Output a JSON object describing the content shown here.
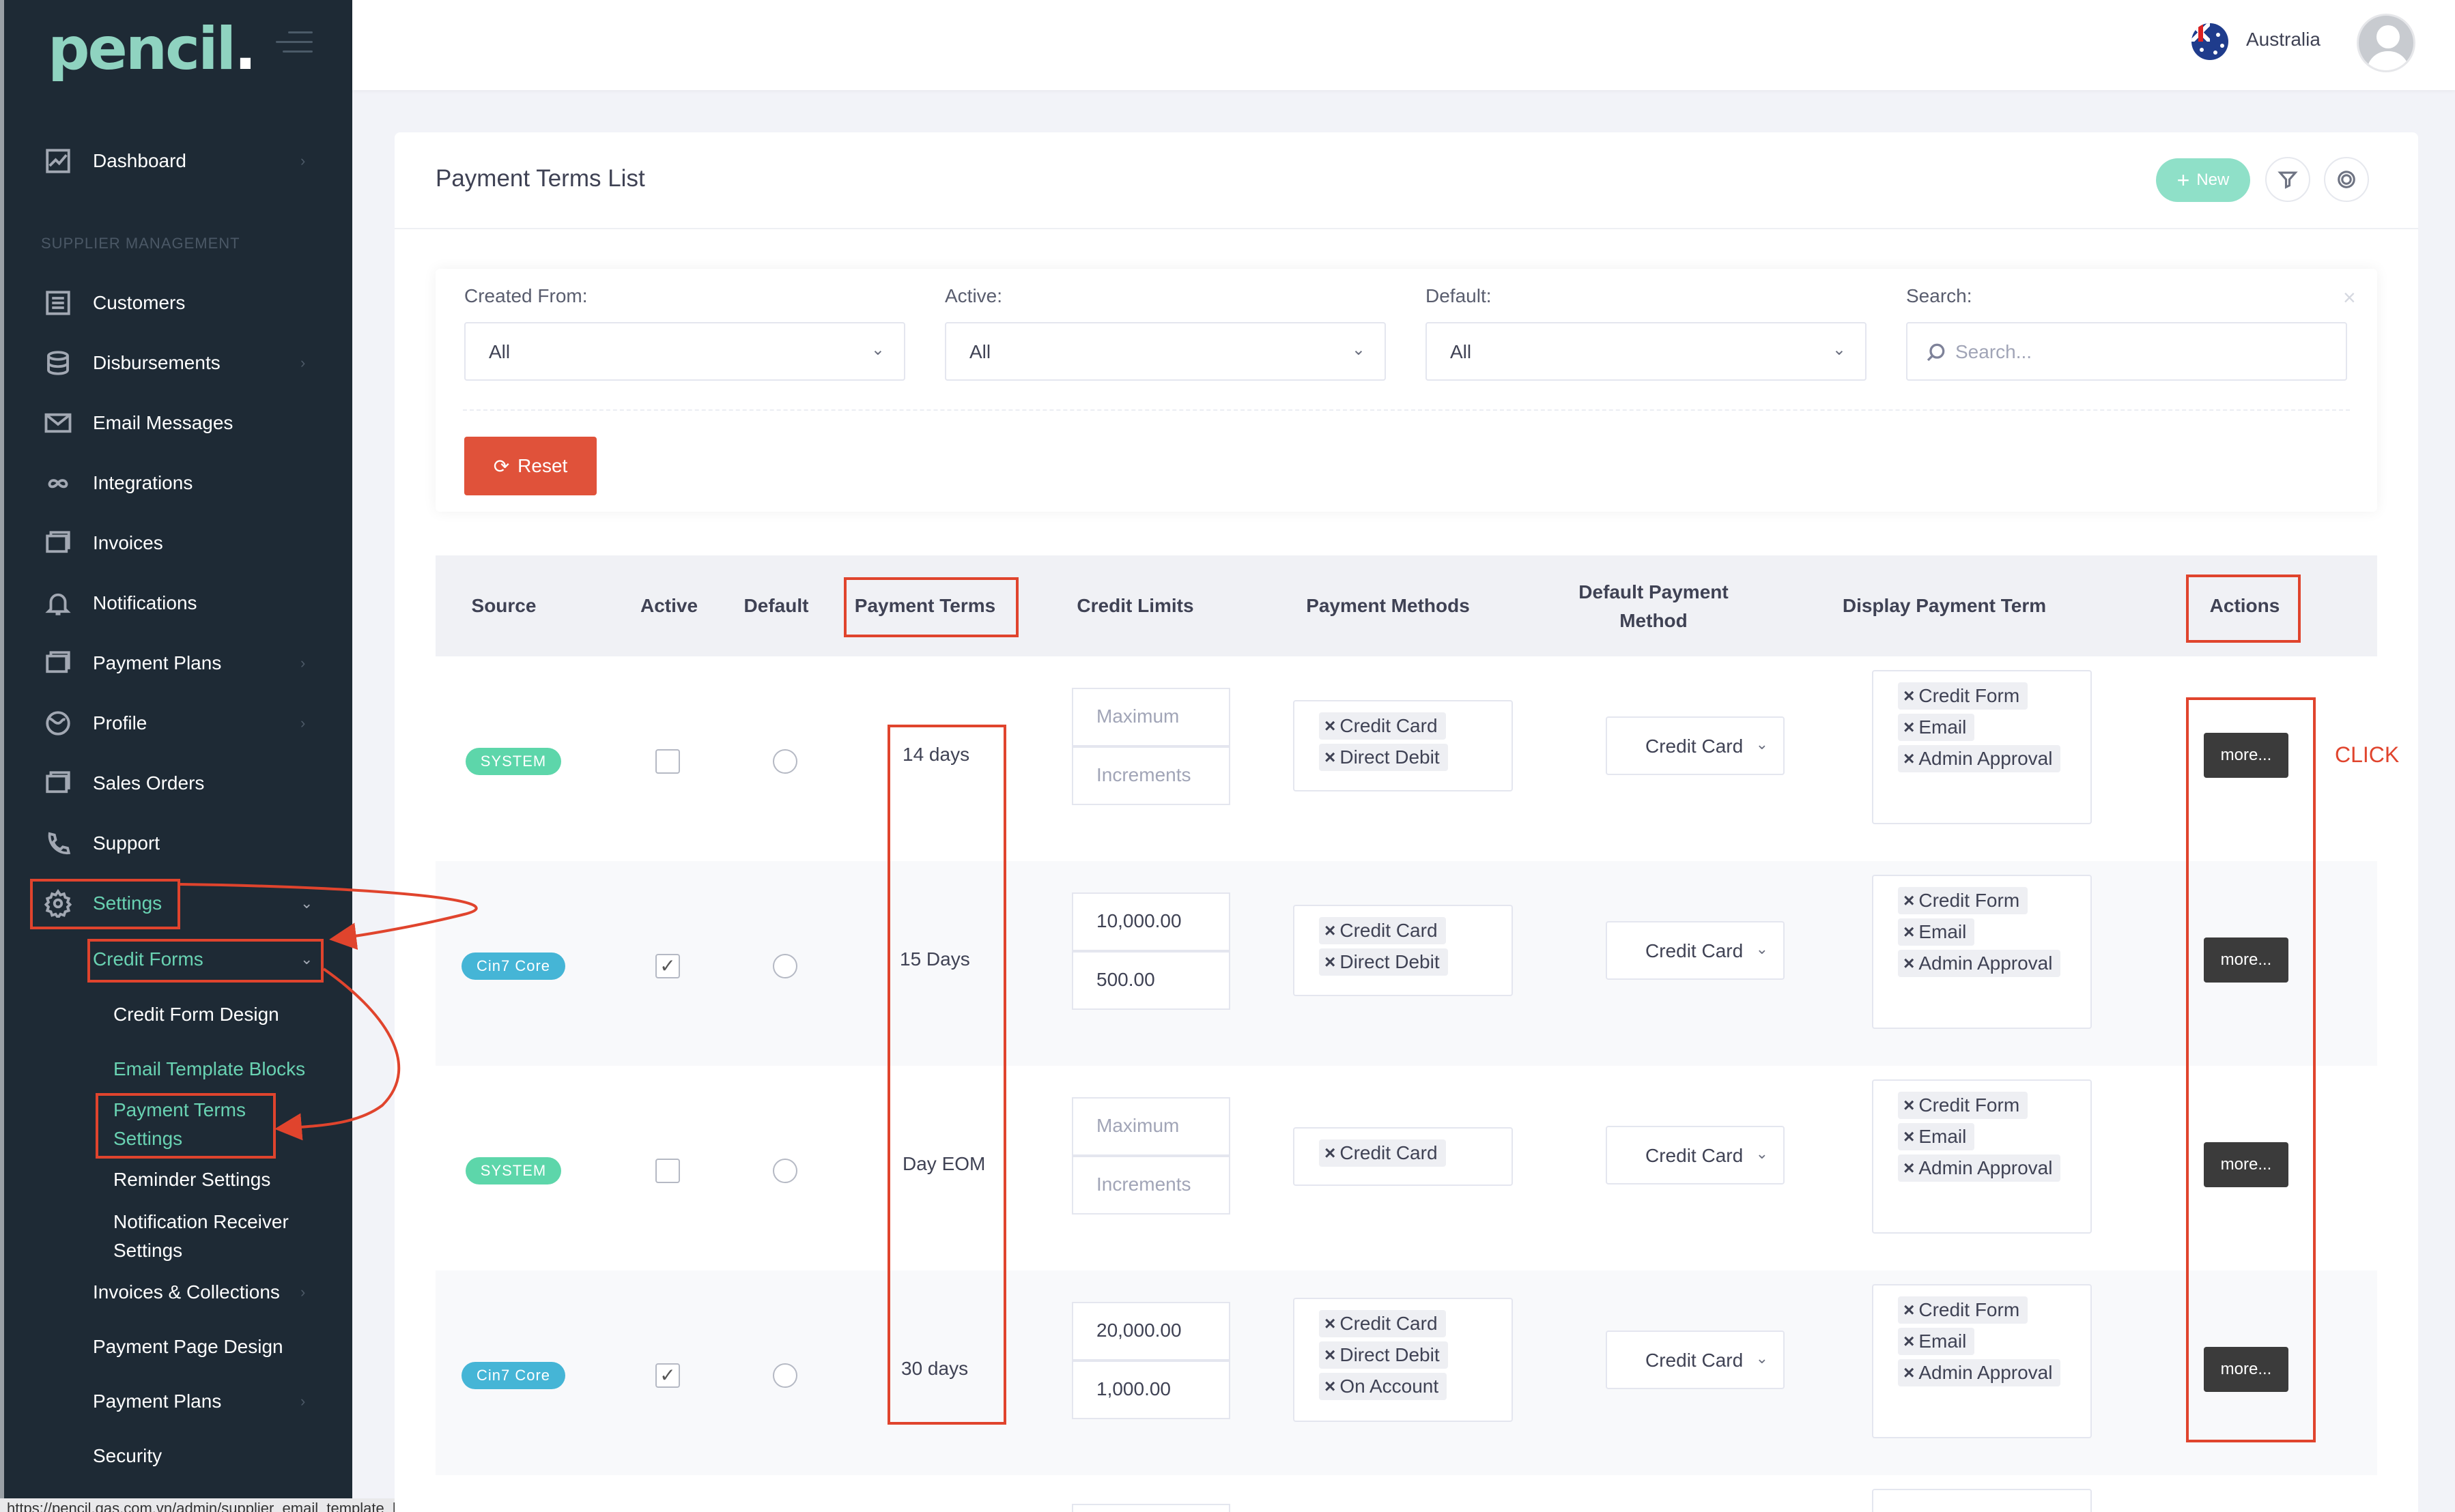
{
  "app": {
    "logo": "pencil",
    "logo_dot": "."
  },
  "header": {
    "country": "Australia"
  },
  "sidebar": {
    "section_label": "SUPPLIER MANAGEMENT",
    "items": [
      {
        "label": "Dashboard",
        "icon": "chart-icon"
      },
      {
        "label": "Customers",
        "icon": "list-icon"
      },
      {
        "label": "Disbursements",
        "icon": "coins-icon"
      },
      {
        "label": "Email Messages",
        "icon": "envelope-icon"
      },
      {
        "label": "Integrations",
        "icon": "infinity-icon"
      },
      {
        "label": "Invoices",
        "icon": "invoice-icon"
      },
      {
        "label": "Notifications",
        "icon": "bell-icon"
      },
      {
        "label": "Payment Plans",
        "icon": "payment-plan-icon"
      },
      {
        "label": "Profile",
        "icon": "globe-icon"
      },
      {
        "label": "Sales Orders",
        "icon": "sales-icon"
      },
      {
        "label": "Support",
        "icon": "phone-icon"
      },
      {
        "label": "Settings",
        "icon": "gear-icon"
      }
    ],
    "settings_sub": {
      "credit_forms": "Credit Forms",
      "credit_form_children": [
        "Credit Form Design",
        "Email Template Blocks",
        "Payment Terms",
        "Settings",
        "Reminder Settings",
        "Notification Receiver",
        "Settings"
      ],
      "rest": [
        "Invoices & Collections",
        "Payment Page Design",
        "Payment Plans",
        "Security"
      ]
    },
    "status_url": "https://pencil.qas.com.vn/admin/supplier_email_template_blocks"
  },
  "page": {
    "title": "Payment Terms List",
    "new_label": "New"
  },
  "filters": {
    "created_from": {
      "label": "Created From:",
      "value": "All"
    },
    "active": {
      "label": "Active:",
      "value": "All"
    },
    "default": {
      "label": "Default:",
      "value": "All"
    },
    "search": {
      "label": "Search:",
      "placeholder": "Search..."
    },
    "reset_label": "Reset"
  },
  "table": {
    "headers": [
      "Source",
      "Active",
      "Default",
      "Payment Terms",
      "Credit Limits",
      "Payment Methods",
      "Default Payment",
      "Method",
      "Display Payment Term",
      "Actions"
    ],
    "limit_placeholders": {
      "max": "Maximum",
      "inc": "Increments"
    },
    "rows": [
      {
        "source": "SYSTEM",
        "active": false,
        "term": "14 days",
        "max": "",
        "inc": "",
        "methods": [
          "Credit Card",
          "Direct Debit"
        ],
        "default_method": "Credit Card",
        "display": [
          "Credit Form",
          "Email",
          "Admin Approval"
        ],
        "action": "more..."
      },
      {
        "source": "Cin7 Core",
        "active": true,
        "term": "15 Days",
        "max": "10,000.00",
        "inc": "500.00",
        "methods": [
          "Credit Card",
          "Direct Debit"
        ],
        "default_method": "Credit Card",
        "display": [
          "Credit Form",
          "Email",
          "Admin Approval"
        ],
        "action": "more..."
      },
      {
        "source": "SYSTEM",
        "active": false,
        "term": "Day EOM",
        "max": "",
        "inc": "",
        "methods": [
          "Credit Card"
        ],
        "default_method": "Credit Card",
        "display": [
          "Credit Form",
          "Email",
          "Admin Approval"
        ],
        "action": "more..."
      },
      {
        "source": "Cin7 Core",
        "active": true,
        "term": "30 days",
        "max": "20,000.00",
        "inc": "1,000.00",
        "methods": [
          "Credit Card",
          "Direct Debit",
          "On Account"
        ],
        "default_method": "Credit Card",
        "display": [
          "Credit Form",
          "Email",
          "Admin Approval"
        ],
        "action": "more..."
      }
    ]
  },
  "annotation": {
    "click_label": "CLICK"
  },
  "colors": {
    "sidebar": "#1e2a35",
    "accent": "#69d2b2",
    "reset": "#e0523a",
    "annotation": "#e0442d"
  }
}
